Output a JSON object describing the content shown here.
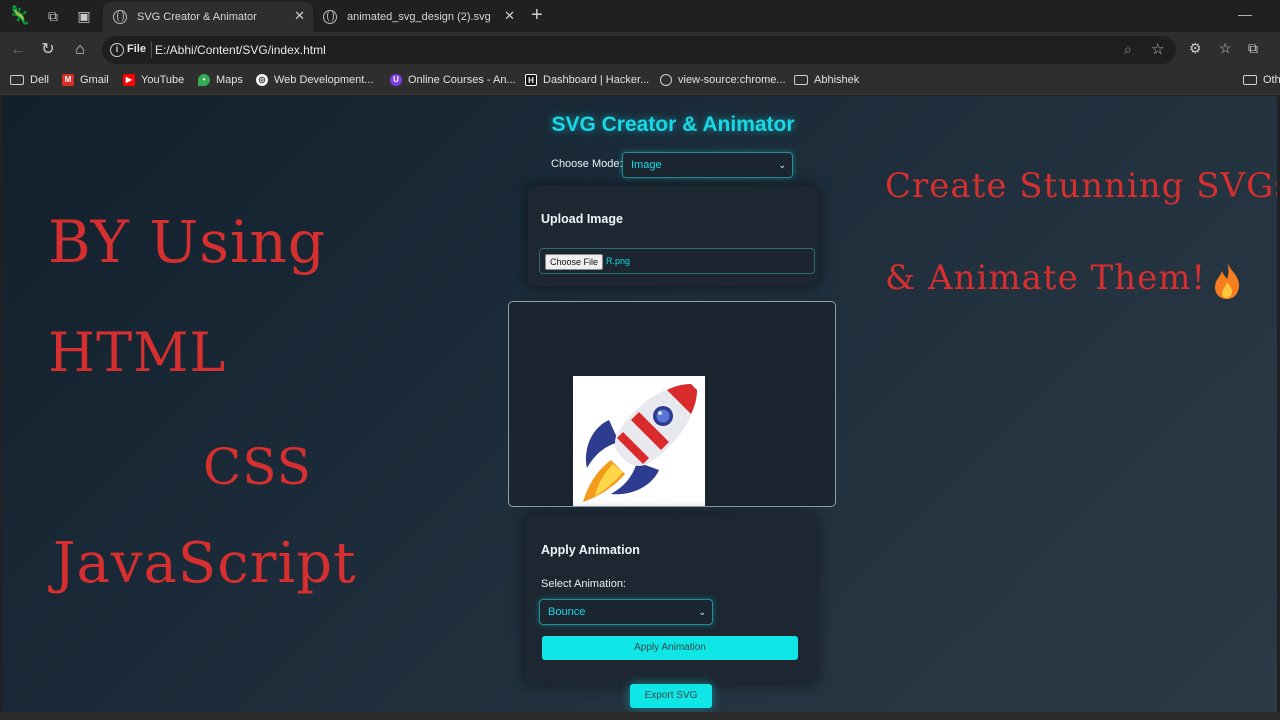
{
  "browser": {
    "tabs": [
      {
        "title": "SVG Creator & Animator",
        "active": true
      },
      {
        "title": "animated_svg_design (2).svg",
        "active": false
      }
    ],
    "address": {
      "scheme_label": "File",
      "url": "E:/Abhi/Content/SVG/index.html"
    },
    "bookmarks": [
      {
        "label": "Dell",
        "icon": "folder-icon"
      },
      {
        "label": "Gmail",
        "icon": "gmail-icon"
      },
      {
        "label": "YouTube",
        "icon": "youtube-icon"
      },
      {
        "label": "Maps",
        "icon": "maps-icon"
      },
      {
        "label": "Web Development...",
        "icon": "web-icon"
      },
      {
        "label": "Online Courses - An...",
        "icon": "courses-icon"
      },
      {
        "label": "Dashboard | Hacker...",
        "icon": "hackerrank-icon"
      },
      {
        "label": "view-source:chrome...",
        "icon": "globe-icon"
      },
      {
        "label": "Abhishek",
        "icon": "folder-icon"
      },
      {
        "label": "Oth",
        "icon": "folder-icon"
      }
    ]
  },
  "overlay": {
    "line1": "BY Using",
    "line2": "HTML",
    "line3": "CSS",
    "line4": "JavaScript",
    "tagline1": "Create Stunning SVGs",
    "tagline2": "& Animate Them!"
  },
  "app": {
    "title": "SVG Creator & Animator",
    "mode_label": "Choose Mode:",
    "mode_value": "Image",
    "upload": {
      "title": "Upload Image",
      "button": "Choose File",
      "file_name": "R.png"
    },
    "animation": {
      "title": "Apply Animation",
      "select_label": "Select Animation:",
      "select_value": "Bounce",
      "apply_button": "Apply Animation"
    },
    "export_button": "Export SVG"
  },
  "colors": {
    "accent": "#19d8e6",
    "overlay_text": "#d62f2f",
    "button": "#10e6e6"
  }
}
